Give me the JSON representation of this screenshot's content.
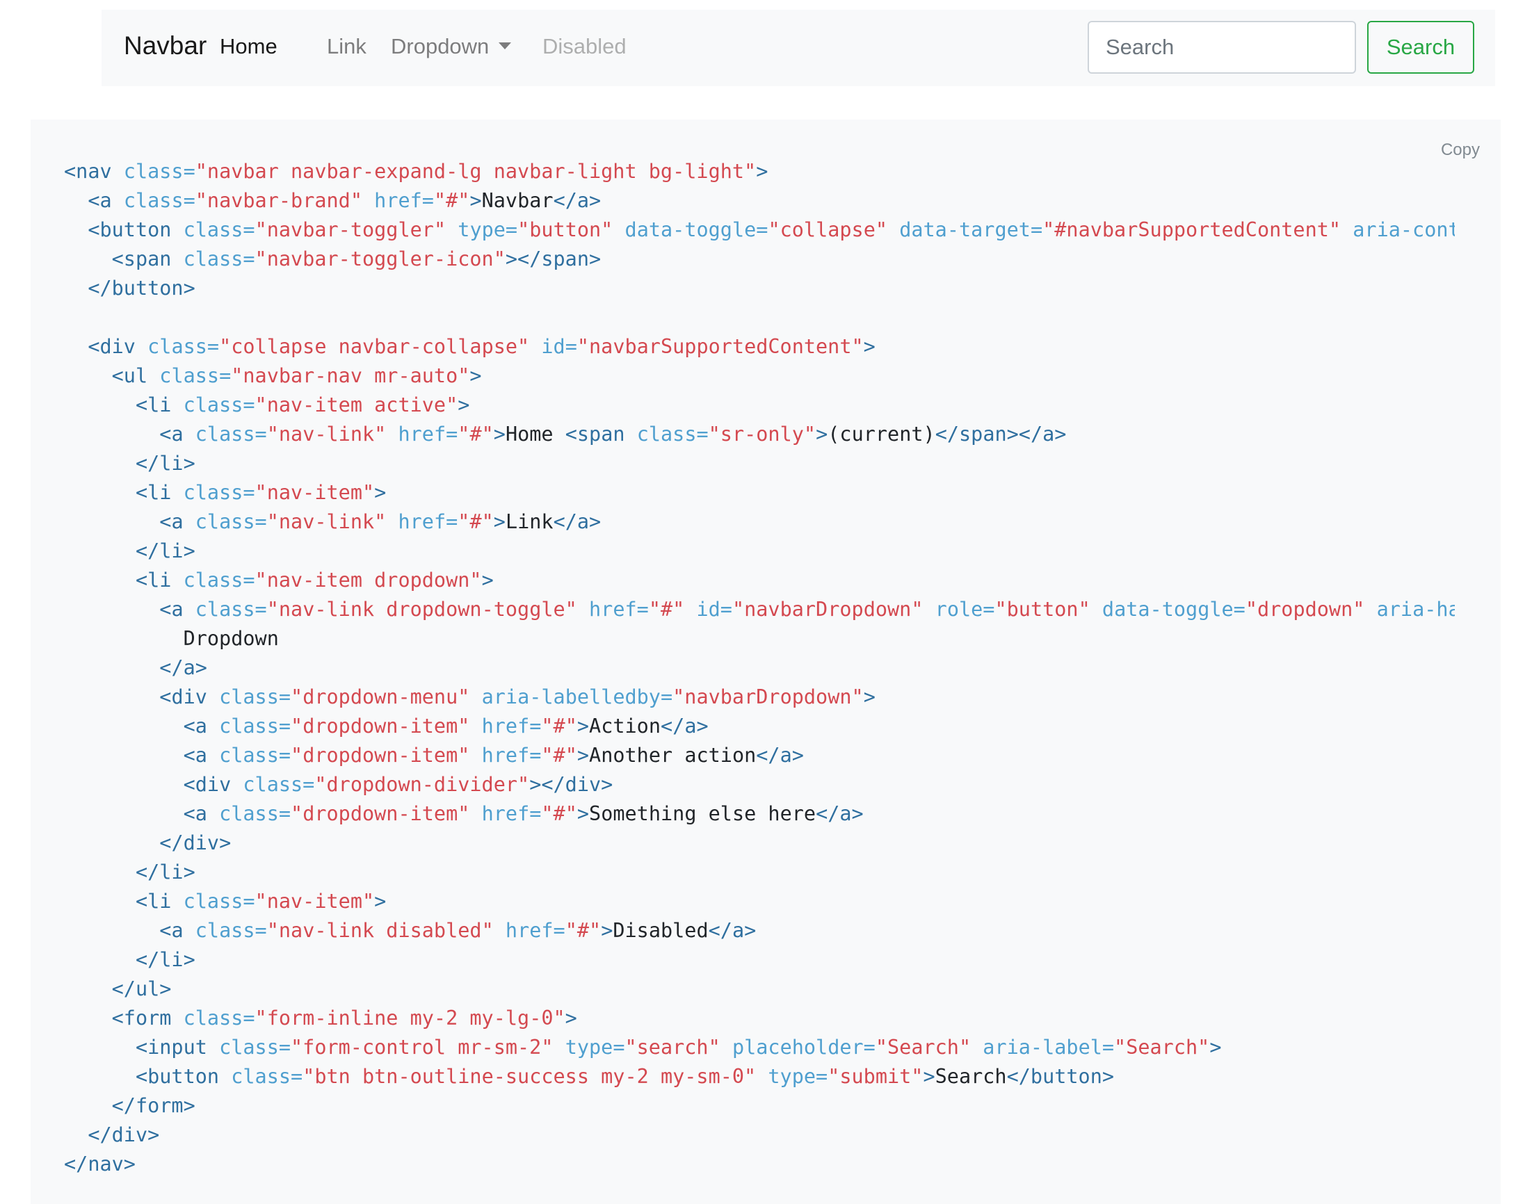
{
  "navbar": {
    "brand": "Navbar",
    "links": [
      {
        "label": "Home",
        "state": "active"
      },
      {
        "label": "Link",
        "state": "normal"
      },
      {
        "label": "Dropdown",
        "state": "dropdown"
      },
      {
        "label": "Disabled",
        "state": "disabled"
      }
    ],
    "search": {
      "placeholder": "Search",
      "value": "",
      "button_label": "Search"
    }
  },
  "code_block": {
    "copy_label": "Copy",
    "lines": [
      [
        [
          "t",
          "<nav "
        ],
        [
          "a",
          "class="
        ],
        [
          "v",
          "\"navbar navbar-expand-lg navbar-light bg-light\""
        ],
        [
          "t",
          ">"
        ]
      ],
      [
        [
          "x",
          "  "
        ],
        [
          "t",
          "<a "
        ],
        [
          "a",
          "class="
        ],
        [
          "v",
          "\"navbar-brand\""
        ],
        [
          "x",
          " "
        ],
        [
          "a",
          "href="
        ],
        [
          "v",
          "\"#\""
        ],
        [
          "t",
          ">"
        ],
        [
          "x",
          "Navbar"
        ],
        [
          "t",
          "</a>"
        ]
      ],
      [
        [
          "x",
          "  "
        ],
        [
          "t",
          "<button "
        ],
        [
          "a",
          "class="
        ],
        [
          "v",
          "\"navbar-toggler\""
        ],
        [
          "x",
          " "
        ],
        [
          "a",
          "type="
        ],
        [
          "v",
          "\"button\""
        ],
        [
          "x",
          " "
        ],
        [
          "a",
          "data-toggle="
        ],
        [
          "v",
          "\"collapse\""
        ],
        [
          "x",
          " "
        ],
        [
          "a",
          "data-target="
        ],
        [
          "v",
          "\"#navbarSupportedContent\""
        ],
        [
          "x",
          " "
        ],
        [
          "a",
          "aria-control"
        ]
      ],
      [
        [
          "x",
          "    "
        ],
        [
          "t",
          "<span "
        ],
        [
          "a",
          "class="
        ],
        [
          "v",
          "\"navbar-toggler-icon\""
        ],
        [
          "t",
          "></span>"
        ]
      ],
      [
        [
          "x",
          "  "
        ],
        [
          "t",
          "</button>"
        ]
      ],
      [
        [
          "x",
          ""
        ]
      ],
      [
        [
          "x",
          "  "
        ],
        [
          "t",
          "<div "
        ],
        [
          "a",
          "class="
        ],
        [
          "v",
          "\"collapse navbar-collapse\""
        ],
        [
          "x",
          " "
        ],
        [
          "a",
          "id="
        ],
        [
          "v",
          "\"navbarSupportedContent\""
        ],
        [
          "t",
          ">"
        ]
      ],
      [
        [
          "x",
          "    "
        ],
        [
          "t",
          "<ul "
        ],
        [
          "a",
          "class="
        ],
        [
          "v",
          "\"navbar-nav mr-auto\""
        ],
        [
          "t",
          ">"
        ]
      ],
      [
        [
          "x",
          "      "
        ],
        [
          "t",
          "<li "
        ],
        [
          "a",
          "class="
        ],
        [
          "v",
          "\"nav-item active\""
        ],
        [
          "t",
          ">"
        ]
      ],
      [
        [
          "x",
          "        "
        ],
        [
          "t",
          "<a "
        ],
        [
          "a",
          "class="
        ],
        [
          "v",
          "\"nav-link\""
        ],
        [
          "x",
          " "
        ],
        [
          "a",
          "href="
        ],
        [
          "v",
          "\"#\""
        ],
        [
          "t",
          ">"
        ],
        [
          "x",
          "Home "
        ],
        [
          "t",
          "<span "
        ],
        [
          "a",
          "class="
        ],
        [
          "v",
          "\"sr-only\""
        ],
        [
          "t",
          ">"
        ],
        [
          "x",
          "(current)"
        ],
        [
          "t",
          "</span></a>"
        ]
      ],
      [
        [
          "x",
          "      "
        ],
        [
          "t",
          "</li>"
        ]
      ],
      [
        [
          "x",
          "      "
        ],
        [
          "t",
          "<li "
        ],
        [
          "a",
          "class="
        ],
        [
          "v",
          "\"nav-item\""
        ],
        [
          "t",
          ">"
        ]
      ],
      [
        [
          "x",
          "        "
        ],
        [
          "t",
          "<a "
        ],
        [
          "a",
          "class="
        ],
        [
          "v",
          "\"nav-link\""
        ],
        [
          "x",
          " "
        ],
        [
          "a",
          "href="
        ],
        [
          "v",
          "\"#\""
        ],
        [
          "t",
          ">"
        ],
        [
          "x",
          "Link"
        ],
        [
          "t",
          "</a>"
        ]
      ],
      [
        [
          "x",
          "      "
        ],
        [
          "t",
          "</li>"
        ]
      ],
      [
        [
          "x",
          "      "
        ],
        [
          "t",
          "<li "
        ],
        [
          "a",
          "class="
        ],
        [
          "v",
          "\"nav-item dropdown\""
        ],
        [
          "t",
          ">"
        ]
      ],
      [
        [
          "x",
          "        "
        ],
        [
          "t",
          "<a "
        ],
        [
          "a",
          "class="
        ],
        [
          "v",
          "\"nav-link dropdown-toggle\""
        ],
        [
          "x",
          " "
        ],
        [
          "a",
          "href="
        ],
        [
          "v",
          "\"#\""
        ],
        [
          "x",
          " "
        ],
        [
          "a",
          "id="
        ],
        [
          "v",
          "\"navbarDropdown\""
        ],
        [
          "x",
          " "
        ],
        [
          "a",
          "role="
        ],
        [
          "v",
          "\"button\""
        ],
        [
          "x",
          " "
        ],
        [
          "a",
          "data-toggle="
        ],
        [
          "v",
          "\"dropdown\""
        ],
        [
          "x",
          " "
        ],
        [
          "a",
          "aria-haspo"
        ]
      ],
      [
        [
          "x",
          "          Dropdown"
        ]
      ],
      [
        [
          "x",
          "        "
        ],
        [
          "t",
          "</a>"
        ]
      ],
      [
        [
          "x",
          "        "
        ],
        [
          "t",
          "<div "
        ],
        [
          "a",
          "class="
        ],
        [
          "v",
          "\"dropdown-menu\""
        ],
        [
          "x",
          " "
        ],
        [
          "a",
          "aria-labelledby="
        ],
        [
          "v",
          "\"navbarDropdown\""
        ],
        [
          "t",
          ">"
        ]
      ],
      [
        [
          "x",
          "          "
        ],
        [
          "t",
          "<a "
        ],
        [
          "a",
          "class="
        ],
        [
          "v",
          "\"dropdown-item\""
        ],
        [
          "x",
          " "
        ],
        [
          "a",
          "href="
        ],
        [
          "v",
          "\"#\""
        ],
        [
          "t",
          ">"
        ],
        [
          "x",
          "Action"
        ],
        [
          "t",
          "</a>"
        ]
      ],
      [
        [
          "x",
          "          "
        ],
        [
          "t",
          "<a "
        ],
        [
          "a",
          "class="
        ],
        [
          "v",
          "\"dropdown-item\""
        ],
        [
          "x",
          " "
        ],
        [
          "a",
          "href="
        ],
        [
          "v",
          "\"#\""
        ],
        [
          "t",
          ">"
        ],
        [
          "x",
          "Another action"
        ],
        [
          "t",
          "</a>"
        ]
      ],
      [
        [
          "x",
          "          "
        ],
        [
          "t",
          "<div "
        ],
        [
          "a",
          "class="
        ],
        [
          "v",
          "\"dropdown-divider\""
        ],
        [
          "t",
          "></div>"
        ]
      ],
      [
        [
          "x",
          "          "
        ],
        [
          "t",
          "<a "
        ],
        [
          "a",
          "class="
        ],
        [
          "v",
          "\"dropdown-item\""
        ],
        [
          "x",
          " "
        ],
        [
          "a",
          "href="
        ],
        [
          "v",
          "\"#\""
        ],
        [
          "t",
          ">"
        ],
        [
          "x",
          "Something else here"
        ],
        [
          "t",
          "</a>"
        ]
      ],
      [
        [
          "x",
          "        "
        ],
        [
          "t",
          "</div>"
        ]
      ],
      [
        [
          "x",
          "      "
        ],
        [
          "t",
          "</li>"
        ]
      ],
      [
        [
          "x",
          "      "
        ],
        [
          "t",
          "<li "
        ],
        [
          "a",
          "class="
        ],
        [
          "v",
          "\"nav-item\""
        ],
        [
          "t",
          ">"
        ]
      ],
      [
        [
          "x",
          "        "
        ],
        [
          "t",
          "<a "
        ],
        [
          "a",
          "class="
        ],
        [
          "v",
          "\"nav-link disabled\""
        ],
        [
          "x",
          " "
        ],
        [
          "a",
          "href="
        ],
        [
          "v",
          "\"#\""
        ],
        [
          "t",
          ">"
        ],
        [
          "x",
          "Disabled"
        ],
        [
          "t",
          "</a>"
        ]
      ],
      [
        [
          "x",
          "      "
        ],
        [
          "t",
          "</li>"
        ]
      ],
      [
        [
          "x",
          "    "
        ],
        [
          "t",
          "</ul>"
        ]
      ],
      [
        [
          "x",
          "    "
        ],
        [
          "t",
          "<form "
        ],
        [
          "a",
          "class="
        ],
        [
          "v",
          "\"form-inline my-2 my-lg-0\""
        ],
        [
          "t",
          ">"
        ]
      ],
      [
        [
          "x",
          "      "
        ],
        [
          "t",
          "<input "
        ],
        [
          "a",
          "class="
        ],
        [
          "v",
          "\"form-control mr-sm-2\""
        ],
        [
          "x",
          " "
        ],
        [
          "a",
          "type="
        ],
        [
          "v",
          "\"search\""
        ],
        [
          "x",
          " "
        ],
        [
          "a",
          "placeholder="
        ],
        [
          "v",
          "\"Search\""
        ],
        [
          "x",
          " "
        ],
        [
          "a",
          "aria-label="
        ],
        [
          "v",
          "\"Search\""
        ],
        [
          "t",
          ">"
        ]
      ],
      [
        [
          "x",
          "      "
        ],
        [
          "t",
          "<button "
        ],
        [
          "a",
          "class="
        ],
        [
          "v",
          "\"btn btn-outline-success my-2 my-sm-0\""
        ],
        [
          "x",
          " "
        ],
        [
          "a",
          "type="
        ],
        [
          "v",
          "\"submit\""
        ],
        [
          "t",
          ">"
        ],
        [
          "x",
          "Search"
        ],
        [
          "t",
          "</button>"
        ]
      ],
      [
        [
          "x",
          "    "
        ],
        [
          "t",
          "</form>"
        ]
      ],
      [
        [
          "x",
          "  "
        ],
        [
          "t",
          "</div>"
        ]
      ],
      [
        [
          "t",
          "</nav>"
        ]
      ]
    ]
  },
  "colors": {
    "navbar_bg": "#f8f9fa",
    "code_bg": "#f8f9fa",
    "success": "#28a745",
    "code_tag": "#2f6f9f",
    "code_attr": "#4f9fcf",
    "code_value": "#d44950"
  }
}
